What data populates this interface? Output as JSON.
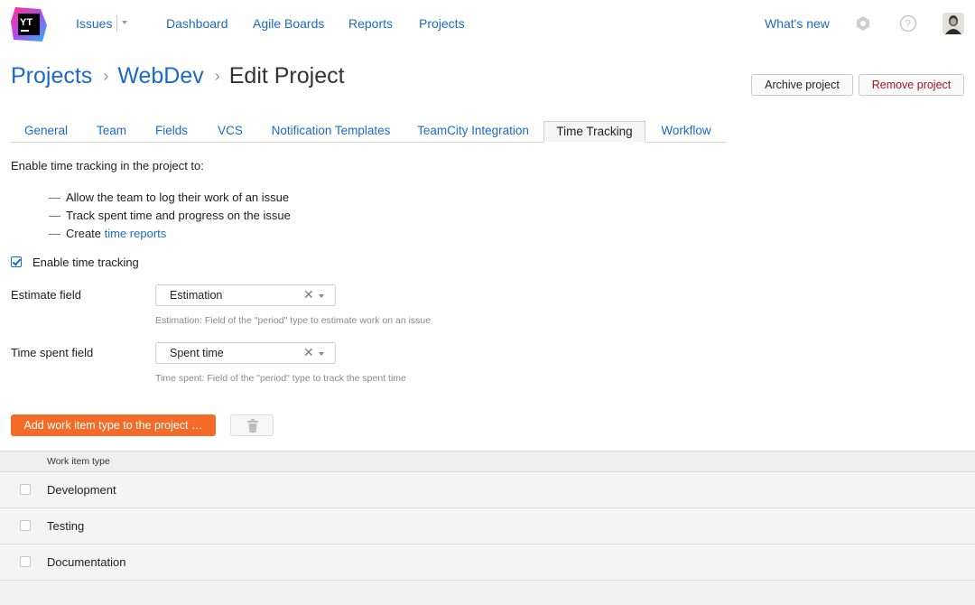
{
  "header": {
    "logo_text": "YT",
    "nav": {
      "issues": "Issues",
      "dashboard": "Dashboard",
      "agile_boards": "Agile Boards",
      "reports": "Reports",
      "projects": "Projects"
    },
    "whats_new": "What's new"
  },
  "breadcrumb": {
    "projects": "Projects",
    "project": "WebDev",
    "current": "Edit Project",
    "separator": "›"
  },
  "actions": {
    "archive": "Archive project",
    "remove": "Remove project"
  },
  "tabs": [
    {
      "label": "General"
    },
    {
      "label": "Team"
    },
    {
      "label": "Fields"
    },
    {
      "label": "VCS"
    },
    {
      "label": "Notification Templates"
    },
    {
      "label": "TeamCity Integration"
    },
    {
      "label": "Time Tracking",
      "active": true
    },
    {
      "label": "Workflow"
    }
  ],
  "time_tracking": {
    "intro": "Enable time tracking in the project to:",
    "bullets": {
      "dash": "—",
      "b1": "Allow the team to log their work of an issue",
      "b2": "Track spent time and progress on the issue",
      "b3_prefix": "Create ",
      "b3_link": "time reports"
    },
    "enable_label": "Enable time tracking",
    "enable_checked": true,
    "estimate": {
      "label": "Estimate field",
      "value": "Estimation",
      "hint": "Estimation: Field of the \"period\" type to estimate work on an issue"
    },
    "spent": {
      "label": "Time spent field",
      "value": "Spent time",
      "hint": "Time spent: Field of the \"period\" type to track the spent time"
    },
    "add_button": "Add work item type to the project …"
  },
  "work_items": {
    "header": "Work item type",
    "rows": [
      {
        "label": "Development"
      },
      {
        "label": "Testing"
      },
      {
        "label": "Documentation"
      }
    ]
  },
  "colors": {
    "link": "#1b6ac9",
    "primary_button": "#f46b28",
    "danger_text": "#a8131a"
  }
}
